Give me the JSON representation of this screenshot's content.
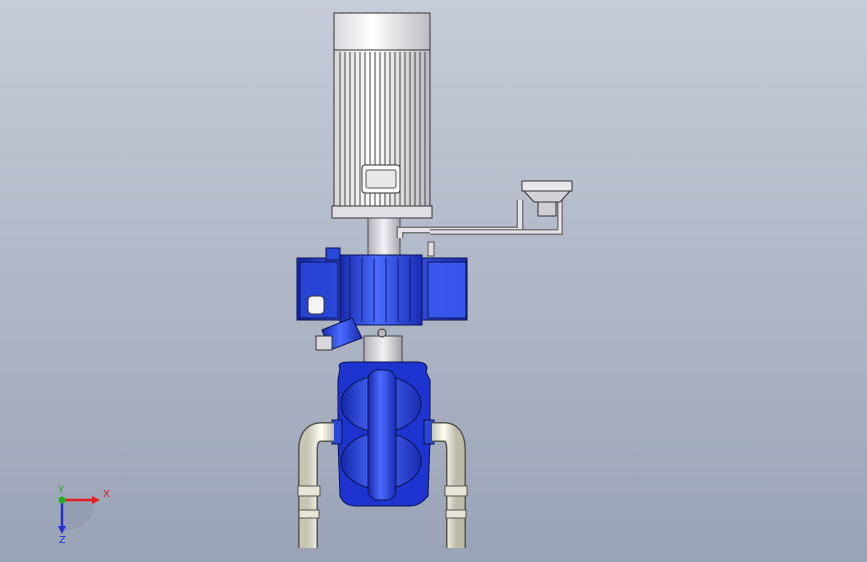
{
  "viewport": {
    "background_top": "#c6ccd8",
    "background_bottom": "#9aa3b6"
  },
  "model": {
    "motor_color": "#f4f4f4",
    "pump_blue": "#2e4ff0",
    "pump_dark_blue": "#1628a8",
    "pipe_cream": "#f0eee0",
    "metal_gray": "#c8c8cc"
  },
  "triad": {
    "x_label": "X",
    "y_label": "Y",
    "z_label": "Z",
    "x_color": "#e02020",
    "y_color": "#20b020",
    "z_color": "#2030d0"
  }
}
